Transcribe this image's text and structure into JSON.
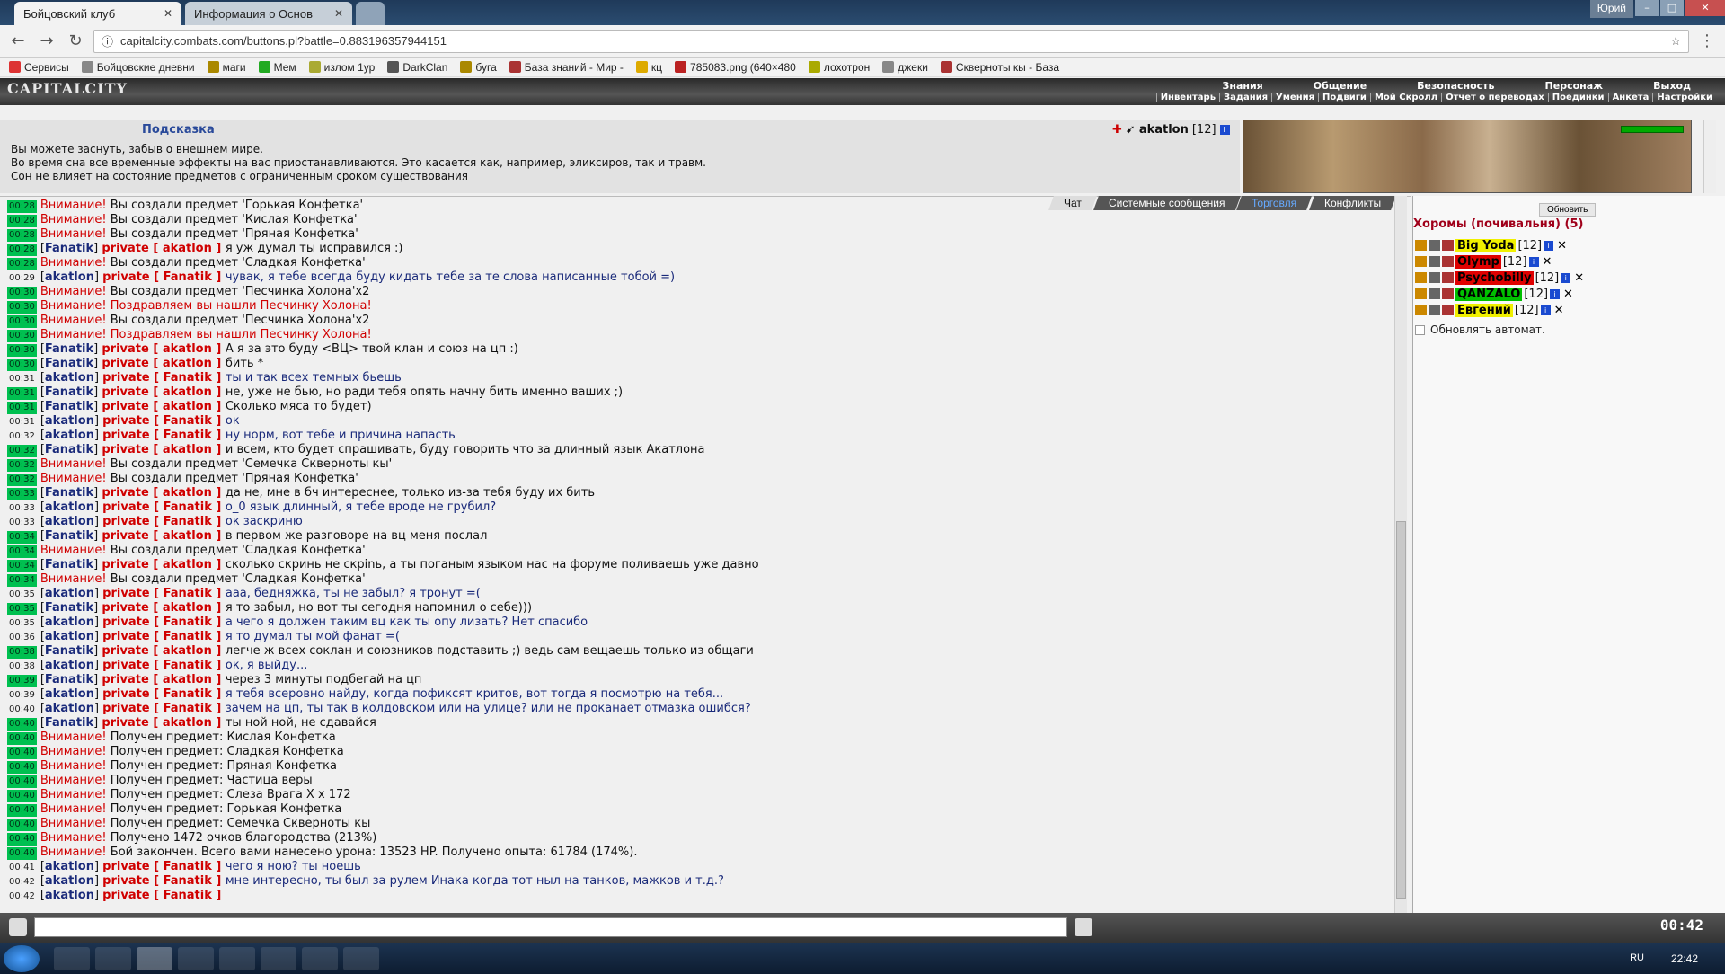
{
  "browser": {
    "tabs": [
      {
        "label": "Бойцовский клуб",
        "active": true
      },
      {
        "label": "Информация о Основ",
        "active": false
      }
    ],
    "user": "Юрий",
    "url": "capitalcity.combats.com/buttons.pl?battle=0.883196357944151",
    "bookmarks": [
      "Сервисы",
      "Бойцовские дневни",
      "маги",
      "Мем",
      "излом 1ур",
      "DarkClan",
      "буга",
      "База знаний - Мир -",
      "кц",
      "785083.png (640×480",
      "лохотрон",
      "джеки",
      "Скверноты кы - База"
    ]
  },
  "game": {
    "logo": "CAPITALCITY",
    "top_menu": [
      "Знания",
      "Общение",
      "Безопасность",
      "Персонаж",
      "Выход"
    ],
    "sub_menu": [
      "Инвентарь",
      "Задания",
      "Умения",
      "Подвиги",
      "Мой Скролл",
      "Отчет о переводах",
      "Поединки",
      "Анкета",
      "Настройки"
    ],
    "hint": {
      "title": "Подсказка",
      "lines": [
        "Вы можете заснуть, забыв о внешнем мире.",
        "Во время сна все временные эффекты на вас приостанавливаются. Это касается как, например, эликсиров, так и травм.",
        "Сон не влияет на состояние предметов с ограниченным сроком существования"
      ],
      "user": "akatlon",
      "user_level": "[12]"
    },
    "chat_tabs": [
      "Чат",
      "Системные сообщения",
      "Торговля",
      "Конфликты"
    ],
    "room": {
      "refresh_label": "Обновить",
      "title": "Хоромы (почивальня) (5)",
      "players": [
        {
          "name": "Big Yoda",
          "level": "[12]",
          "color": "#f0f000"
        },
        {
          "name": "Olymp",
          "level": "[12]",
          "color": "#e00000"
        },
        {
          "name": "Psychobilly",
          "level": "[12]",
          "color": "#e00000"
        },
        {
          "name": "QANZALO",
          "level": "[12]",
          "color": "#00c000"
        },
        {
          "name": "Евгений",
          "level": "[12]",
          "color": "#f0f000"
        }
      ],
      "auto_refresh": "Обновлять автомат."
    },
    "clock": "00:42"
  },
  "chat": [
    {
      "t": "00:28",
      "hl": true,
      "type": "sys",
      "text": "Вы создали предмет 'Горькая Конфетка'"
    },
    {
      "t": "00:28",
      "hl": true,
      "type": "sys",
      "text": "Вы создали предмет 'Кислая Конфетка'"
    },
    {
      "t": "00:28",
      "hl": true,
      "type": "sys",
      "text": "Вы создали предмет 'Пряная Конфетка'"
    },
    {
      "t": "00:28",
      "hl": true,
      "type": "pm",
      "from": "Fanatik",
      "to": "akatlon",
      "text": "я уж думал ты исправился :)"
    },
    {
      "t": "00:28",
      "hl": true,
      "type": "sys",
      "text": "Вы создали предмет 'Сладкая Конфетка'"
    },
    {
      "t": "00:29",
      "hl": false,
      "type": "pm",
      "from": "akatlon",
      "to": "Fanatik",
      "text": "чувак, я тебе всегда буду кидать тебе за те слова написанные тобой =)"
    },
    {
      "t": "00:30",
      "hl": true,
      "type": "sys",
      "text": "Вы создали предмет 'Песчинка Холона'x2"
    },
    {
      "t": "00:30",
      "hl": true,
      "type": "sysred",
      "text": "Поздравляем вы нашли Песчинку Холона!"
    },
    {
      "t": "00:30",
      "hl": true,
      "type": "sys",
      "text": "Вы создали предмет 'Песчинка Холона'x2"
    },
    {
      "t": "00:30",
      "hl": true,
      "type": "sysred",
      "text": "Поздравляем вы нашли Песчинку Холона!"
    },
    {
      "t": "00:30",
      "hl": true,
      "type": "pm",
      "from": "Fanatik",
      "to": "akatlon",
      "text": "А я за это буду <ВЦ> твой клан и союз на цп :)"
    },
    {
      "t": "00:30",
      "hl": true,
      "type": "pm",
      "from": "Fanatik",
      "to": "akatlon",
      "text": "бить *"
    },
    {
      "t": "00:31",
      "hl": false,
      "type": "pm",
      "from": "akatlon",
      "to": "Fanatik",
      "text": "ты и так всех темных бьешь"
    },
    {
      "t": "00:31",
      "hl": true,
      "type": "pm",
      "from": "Fanatik",
      "to": "akatlon",
      "text": "не, уже не бью, но ради тебя опять начну бить именно ваших ;)"
    },
    {
      "t": "00:31",
      "hl": true,
      "type": "pm",
      "from": "Fanatik",
      "to": "akatlon",
      "text": "Сколько мяса то будет)"
    },
    {
      "t": "00:31",
      "hl": false,
      "type": "pm",
      "from": "akatlon",
      "to": "Fanatik",
      "text": "ок"
    },
    {
      "t": "00:32",
      "hl": false,
      "type": "pm",
      "from": "akatlon",
      "to": "Fanatik",
      "text": "ну норм, вот тебе и причина напасть"
    },
    {
      "t": "00:32",
      "hl": true,
      "type": "pm",
      "from": "Fanatik",
      "to": "akatlon",
      "text": "и всем, кто будет спрашивать, буду говорить что за длинный язык Акатлона"
    },
    {
      "t": "00:32",
      "hl": true,
      "type": "sys",
      "text": "Вы создали предмет 'Семечка Скверноты кы'"
    },
    {
      "t": "00:32",
      "hl": true,
      "type": "sys",
      "text": "Вы создали предмет 'Пряная Конфетка'"
    },
    {
      "t": "00:33",
      "hl": true,
      "type": "pm",
      "from": "Fanatik",
      "to": "akatlon",
      "text": "да не, мне в бч интереснее, только из-за тебя буду их бить"
    },
    {
      "t": "00:33",
      "hl": false,
      "type": "pm",
      "from": "akatlon",
      "to": "Fanatik",
      "text": "о_0 язык длинный, я тебе вроде не грубил?"
    },
    {
      "t": "00:33",
      "hl": false,
      "type": "pm",
      "from": "akatlon",
      "to": "Fanatik",
      "text": "ок заскриню"
    },
    {
      "t": "00:34",
      "hl": true,
      "type": "pm",
      "from": "Fanatik",
      "to": "akatlon",
      "text": "в первом же разговоре на вц меня послал"
    },
    {
      "t": "00:34",
      "hl": true,
      "type": "sys",
      "text": "Вы создали предмет 'Сладкая Конфетка'"
    },
    {
      "t": "00:34",
      "hl": true,
      "type": "pm",
      "from": "Fanatik",
      "to": "akatlon",
      "text": "сколько скринь не скрinь, а ты поганым языком нас на форуме поливаешь уже давно"
    },
    {
      "t": "00:34",
      "hl": true,
      "type": "sys",
      "text": "Вы создали предмет 'Сладкая Конфетка'"
    },
    {
      "t": "00:35",
      "hl": false,
      "type": "pm",
      "from": "akatlon",
      "to": "Fanatik",
      "text": "ааа, бедняжка, ты не забыл? я тронут =("
    },
    {
      "t": "00:35",
      "hl": true,
      "type": "pm",
      "from": "Fanatik",
      "to": "akatlon",
      "text": "я то забыл, но вот ты сегодня напомнил о себе)))"
    },
    {
      "t": "00:35",
      "hl": false,
      "type": "pm",
      "from": "akatlon",
      "to": "Fanatik",
      "text": "а чего я должен таким вц как ты опу лизать? Нет спасибо"
    },
    {
      "t": "00:36",
      "hl": false,
      "type": "pm",
      "from": "akatlon",
      "to": "Fanatik",
      "text": "я то думал ты мой фанат =("
    },
    {
      "t": "00:38",
      "hl": true,
      "type": "pm",
      "from": "Fanatik",
      "to": "akatlon",
      "text": "легче ж всех соклан и союзников подставить ;) ведь сам вещаешь только из общаги"
    },
    {
      "t": "00:38",
      "hl": false,
      "type": "pm",
      "from": "akatlon",
      "to": "Fanatik",
      "text": "ок, я выйду..."
    },
    {
      "t": "00:39",
      "hl": true,
      "type": "pm",
      "from": "Fanatik",
      "to": "akatlon",
      "text": "через 3 минуты подбегай на цп"
    },
    {
      "t": "00:39",
      "hl": false,
      "type": "pm",
      "from": "akatlon",
      "to": "Fanatik",
      "text": "я тебя всеровно найду, когда пофиксят критов, вот тогда я посмотрю на тебя..."
    },
    {
      "t": "00:40",
      "hl": false,
      "type": "pm",
      "from": "akatlon",
      "to": "Fanatik",
      "text": "зачем на цп, ты так в колдовском или на улице? или не проканает отмазка ошибся?"
    },
    {
      "t": "00:40",
      "hl": true,
      "type": "pm",
      "from": "Fanatik",
      "to": "akatlon",
      "text": "ты ной ной, не сдавайся"
    },
    {
      "t": "00:40",
      "hl": true,
      "type": "sys",
      "text": "Получен предмет: Кислая Конфетка"
    },
    {
      "t": "00:40",
      "hl": true,
      "type": "sys",
      "text": "Получен предмет: Сладкая Конфетка"
    },
    {
      "t": "00:40",
      "hl": true,
      "type": "sys",
      "text": "Получен предмет: Пряная Конфетка"
    },
    {
      "t": "00:40",
      "hl": true,
      "type": "sys",
      "text": "Получен предмет: Частица веры"
    },
    {
      "t": "00:40",
      "hl": true,
      "type": "sys",
      "text": "Получен предмет: Слеза Врага X x 172"
    },
    {
      "t": "00:40",
      "hl": true,
      "type": "sys",
      "text": "Получен предмет: Горькая Конфетка"
    },
    {
      "t": "00:40",
      "hl": true,
      "type": "sys",
      "text": "Получен предмет: Семечка Скверноты кы"
    },
    {
      "t": "00:40",
      "hl": true,
      "type": "sys",
      "text": "Получено 1472 очков благородства (213%)"
    },
    {
      "t": "00:40",
      "hl": true,
      "type": "sys",
      "text": "Бой закончен. Всего вами нанесено урона: 13523 HP. Получено опыта: 61784 (174%)."
    },
    {
      "t": "00:41",
      "hl": false,
      "type": "pm",
      "from": "akatlon",
      "to": "Fanatik",
      "text": "чего я ною? ты ноешь"
    },
    {
      "t": "00:42",
      "hl": false,
      "type": "pm",
      "from": "akatlon",
      "to": "Fanatik",
      "text": "мне интересно, ты был за рулем Инака когда тот ныл на танков, мажков и т.д.?"
    },
    {
      "t": "00:42",
      "hl": false,
      "type": "pm",
      "from": "akatlon",
      "to": "Fanatik",
      "text": ""
    }
  ],
  "labels": {
    "warn": "Внимание!",
    "private": "private"
  },
  "taskbar": {
    "lang": "RU",
    "time": "22:42"
  }
}
